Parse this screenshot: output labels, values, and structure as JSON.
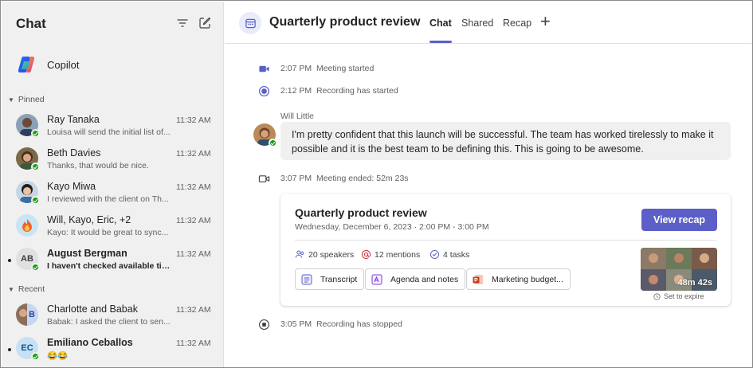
{
  "sidebar": {
    "title": "Chat",
    "copilot_label": "Copilot",
    "pinned_label": "Pinned",
    "recent_label": "Recent",
    "pinned": [
      {
        "name": "Ray Tanaka",
        "preview": "Louisa will send the initial list of...",
        "time": "11:32 AM"
      },
      {
        "name": "Beth Davies",
        "preview": "Thanks, that would be nice.",
        "time": "11:32 AM"
      },
      {
        "name": "Kayo Miwa",
        "preview": "I reviewed with the client on Th...",
        "time": "11:32 AM"
      },
      {
        "name": "Will, Kayo, Eric, +2",
        "preview": "Kayo: It would be great to sync...",
        "time": "11:32 AM"
      },
      {
        "name": "August Bergman",
        "preview": "I haven't checked available tim...",
        "time": "11:32 AM",
        "initials": "AB"
      }
    ],
    "recent": [
      {
        "name": "Charlotte and Babak",
        "preview": "Babak: I asked the client to sen...",
        "time": "11:32 AM",
        "initials": "B"
      },
      {
        "name": "Emiliano Ceballos",
        "preview": "😂😂",
        "time": "11:32 AM",
        "initials": "EC"
      }
    ]
  },
  "header": {
    "title": "Quarterly product review",
    "tabs": [
      "Chat",
      "Shared",
      "Recap"
    ],
    "add_tab": "+"
  },
  "events": {
    "meeting_started": {
      "time": "2:07 PM",
      "text": "Meeting started"
    },
    "recording_started": {
      "time": "2:12 PM",
      "text": "Recording has started"
    },
    "meeting_ended": {
      "time": "3:07 PM",
      "text": "Meeting ended: 52m 23s"
    },
    "recording_stopped": {
      "time": "3:05 PM",
      "text": "Recording has stopped"
    }
  },
  "message": {
    "author": "Will Little",
    "line1": "I'm pretty confident that this launch will be successful. The team has worked tirelessly to make it",
    "line2": "possible and it is the best team to be defining this. This is going to be awesome."
  },
  "recap": {
    "title": "Quarterly product review",
    "date": "Wednesday, December 6, 2023 · 2:00 PM - 3:00 PM",
    "button": "View recap",
    "speakers": "20 speakers",
    "mentions": "12 mentions",
    "tasks": "4 tasks",
    "files": [
      "Transcript",
      "Agenda and notes",
      "Marketing budget..."
    ],
    "duration": "48m 42s",
    "expire": "Set to expire"
  },
  "colors": {
    "accent": "#5b5fc7",
    "presence": "#13a10e",
    "sidebar_bg": "#f0f0f0"
  }
}
